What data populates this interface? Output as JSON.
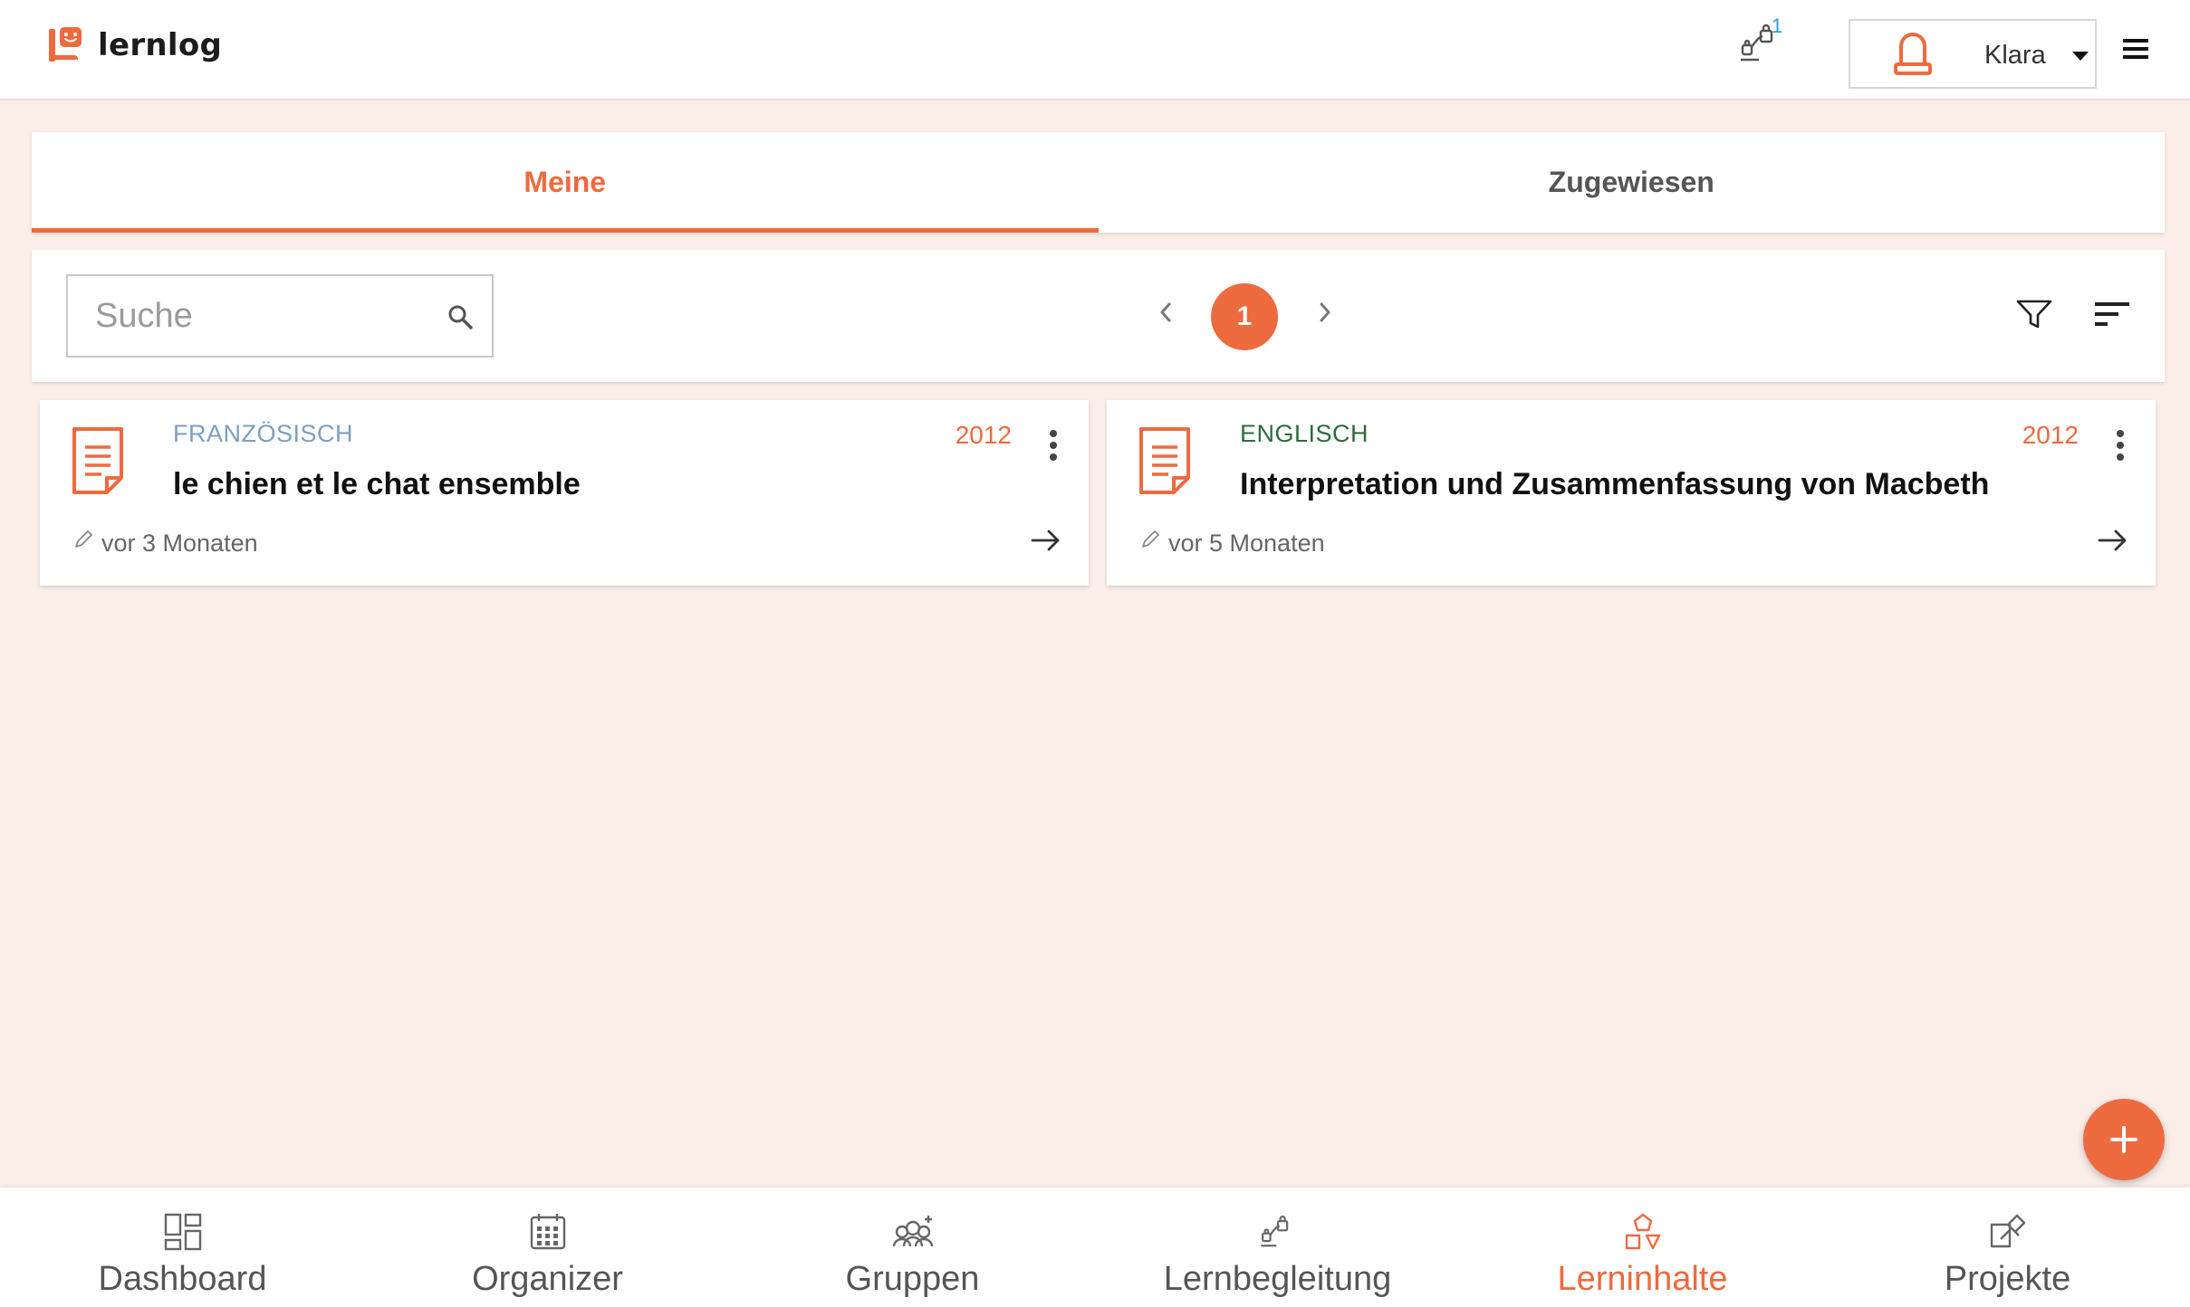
{
  "app": {
    "name": "lernlog"
  },
  "header": {
    "notification_count": "1",
    "user_name": "Klara"
  },
  "tabs": [
    {
      "label": "Meine",
      "active": true
    },
    {
      "label": "Zugewiesen",
      "active": false
    }
  ],
  "toolbar": {
    "search_placeholder": "Suche",
    "current_page": "1"
  },
  "cards": [
    {
      "subject": "FRANZÖSISCH",
      "subject_color": "#7d9fc0",
      "title": "le chien et le chat ensemble",
      "year": "2012",
      "updated": "vor 3 Monaten"
    },
    {
      "subject": "ENGLISCH",
      "subject_color": "#2e6b3e",
      "title": "Interpretation und Zusammenfassung von Macbeth",
      "year": "2012",
      "updated": "vor 5 Monaten"
    }
  ],
  "bottom_nav": [
    {
      "label": "Dashboard",
      "icon": "dashboard-icon",
      "active": false
    },
    {
      "label": "Organizer",
      "icon": "calendar-icon",
      "active": false
    },
    {
      "label": "Gruppen",
      "icon": "groups-icon",
      "active": false
    },
    {
      "label": "Lernbegleitung",
      "icon": "mentoring-icon",
      "active": false
    },
    {
      "label": "Lerninhalte",
      "icon": "shapes-icon",
      "active": true
    },
    {
      "label": "Projekte",
      "icon": "projects-icon",
      "active": false
    }
  ],
  "colors": {
    "accent": "#ee6a3f",
    "background": "#fbeee9",
    "notification_badge": "#2a9fd6"
  }
}
